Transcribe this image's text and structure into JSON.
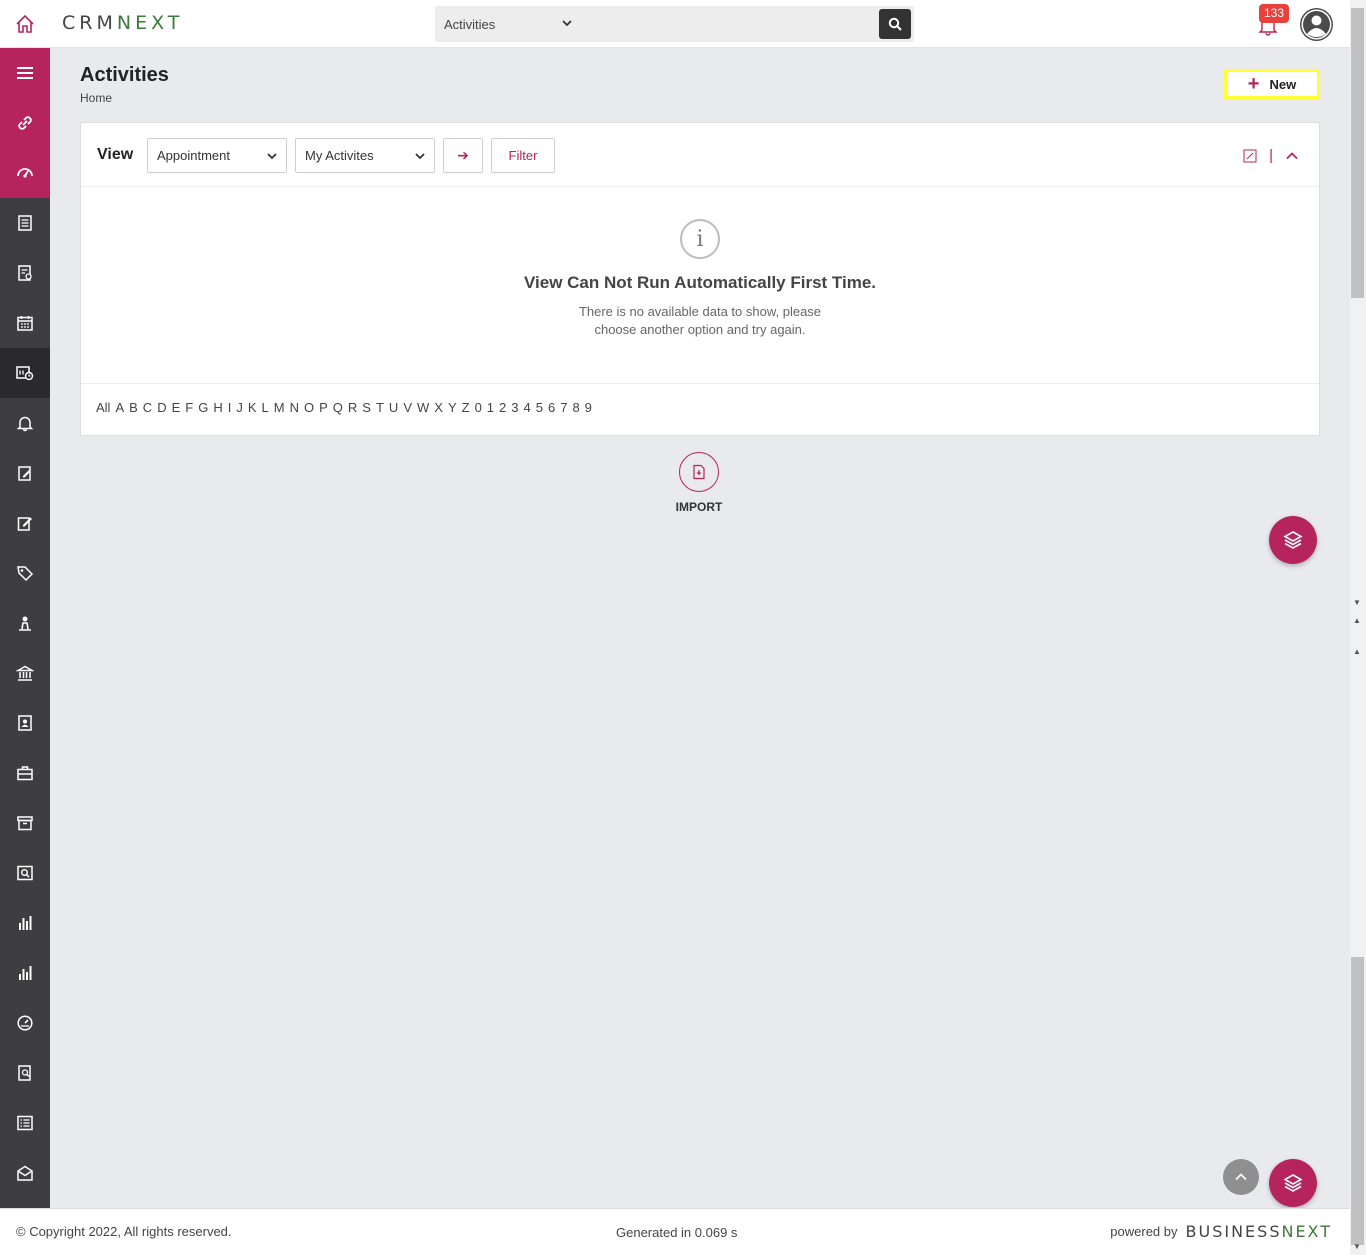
{
  "header": {
    "logo_part1": "CRM",
    "logo_part2": "NEXT",
    "search_scope": "Activities",
    "search_placeholder": "",
    "notification_count": "133"
  },
  "sidebar": {
    "items": [
      {
        "name": "menu-icon"
      },
      {
        "name": "link-icon"
      },
      {
        "name": "dashboard-icon"
      },
      {
        "name": "document-icon"
      },
      {
        "name": "report-doc-icon"
      },
      {
        "name": "calendar-icon"
      },
      {
        "name": "activities-icon"
      },
      {
        "name": "bell-icon"
      },
      {
        "name": "edit-doc-icon"
      },
      {
        "name": "edit-icon"
      },
      {
        "name": "tag-icon"
      },
      {
        "name": "person-icon"
      },
      {
        "name": "bank-icon"
      },
      {
        "name": "contact-card-icon"
      },
      {
        "name": "briefcase-icon"
      },
      {
        "name": "archive-icon"
      },
      {
        "name": "search-doc-icon"
      },
      {
        "name": "bar-chart-icon"
      },
      {
        "name": "bar-chart-2-icon"
      },
      {
        "name": "gauge-icon"
      },
      {
        "name": "doc-search-icon"
      },
      {
        "name": "list-icon"
      },
      {
        "name": "mail-icon"
      }
    ]
  },
  "page": {
    "title": "Activities",
    "breadcrumb": "Home",
    "new_label": "New"
  },
  "view": {
    "label": "View",
    "type_select": "Appointment",
    "scope_select": "My Activites",
    "go_label": "➔",
    "filter_label": "Filter",
    "empty_title": "View Can Not Run Automatically First Time.",
    "empty_sub": "There is no available data to show, please choose another option and try again.",
    "info_glyph": "i",
    "alphabet": [
      "All",
      "A",
      "B",
      "C",
      "D",
      "E",
      "F",
      "G",
      "H",
      "I",
      "J",
      "K",
      "L",
      "M",
      "N",
      "O",
      "P",
      "Q",
      "R",
      "S",
      "T",
      "U",
      "V",
      "W",
      "X",
      "Y",
      "Z",
      "0",
      "1",
      "2",
      "3",
      "4",
      "5",
      "6",
      "7",
      "8",
      "9"
    ]
  },
  "import": {
    "label": "IMPORT"
  },
  "footer": {
    "copyright": "© Copyright 2022, All rights reserved.",
    "generated": "Generated in 0.069 s",
    "powered_by": "powered by",
    "brand_part1": "BUSINESS",
    "brand_part2": "NEXT"
  },
  "colors": {
    "accent": "#b5245c",
    "sidebar": "#3e3e40",
    "highlight": "#ffff35",
    "badge": "#e8413c",
    "brand_green": "#3d7a3a"
  }
}
